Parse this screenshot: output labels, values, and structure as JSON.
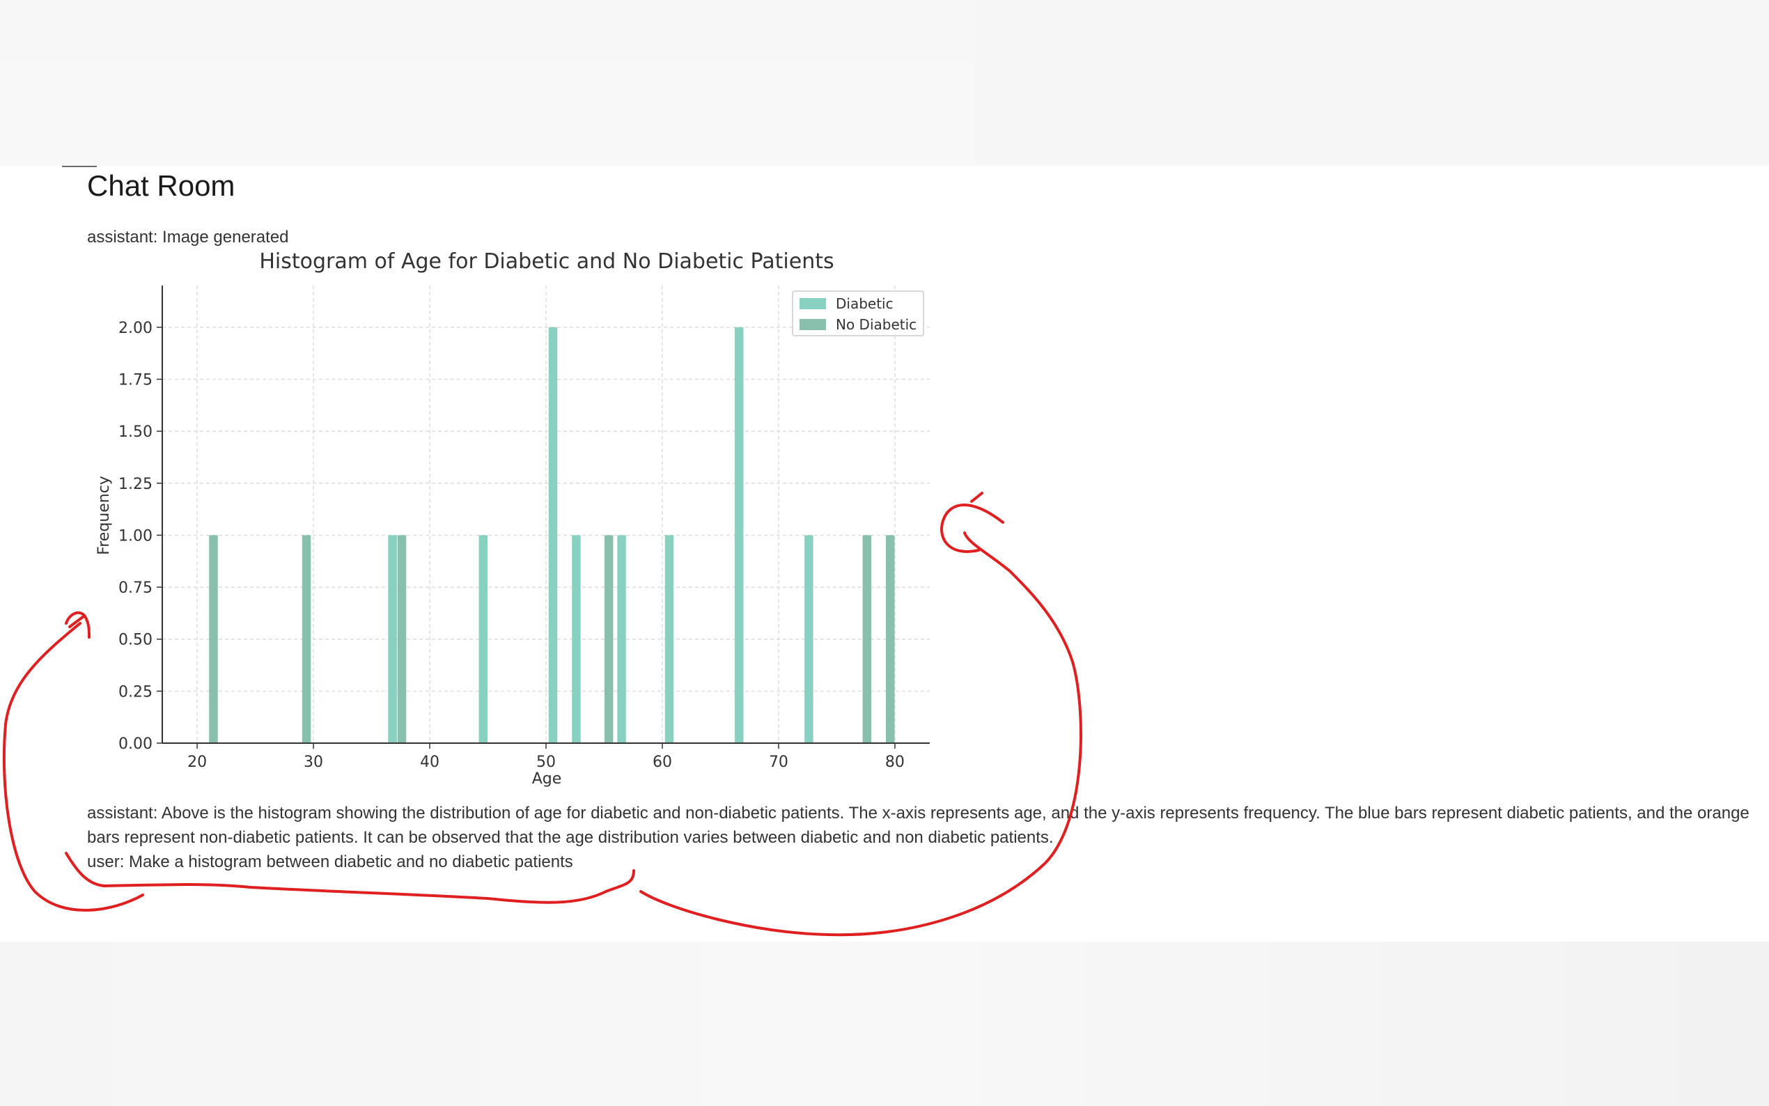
{
  "page": {
    "title": "Chat Room"
  },
  "messages": [
    {
      "role": "assistant",
      "text": "assistant: Image generated"
    },
    {
      "role": "assistant",
      "text": "assistant: Above is the histogram showing the distribution of age for diabetic and non-diabetic patients. The x-axis represents age, and the y-axis represents frequency. The blue bars represent diabetic patients, and the orange bars represent non-diabetic patients. It can be observed that the age distribution varies between diabetic and non diabetic patients."
    },
    {
      "role": "user",
      "text": "user: Make a histogram between diabetic and no diabetic patients"
    }
  ],
  "colors": {
    "diabetic": "#88d1c0",
    "no_diabetic": "#88bfad",
    "annotation": "#e02020"
  },
  "chart_data": {
    "type": "bar",
    "title": "Histogram of Age for Diabetic and No Diabetic Patients",
    "xlabel": "Age",
    "ylabel": "Frequency",
    "xlim": [
      17,
      83
    ],
    "ylim": [
      0,
      2.1
    ],
    "xticks": [
      "20",
      "30",
      "40",
      "50",
      "60",
      "70",
      "80"
    ],
    "yticks": [
      "0.00",
      "0.25",
      "0.50",
      "0.75",
      "1.00",
      "1.25",
      "1.50",
      "1.75",
      "2.00"
    ],
    "grid": true,
    "legend": "top-right",
    "series": [
      {
        "name": "Diabetic",
        "color": "#88d1c0",
        "x": [
          36.8,
          44.6,
          50.6,
          52.6,
          56.5,
          60.6,
          66.6,
          72.6
        ],
        "values": [
          1,
          1,
          2,
          1,
          1,
          1,
          2,
          1
        ]
      },
      {
        "name": "No Diabetic",
        "color": "#88bfad",
        "x": [
          21.4,
          29.4,
          37.6,
          55.4,
          77.6,
          79.6
        ],
        "values": [
          1,
          1,
          1,
          1,
          1,
          1
        ]
      }
    ]
  }
}
